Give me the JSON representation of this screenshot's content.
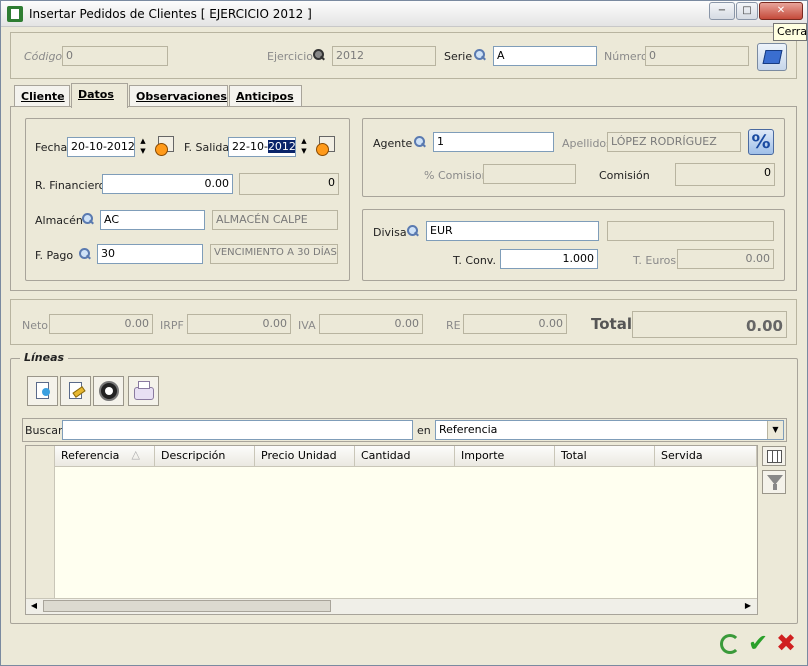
{
  "window": {
    "title": "Insertar Pedidos de Clientes [ EJERCICIO 2012 ]",
    "tooltip": "Cerrar"
  },
  "titlebar": {
    "min_glyph": "−",
    "max_glyph": "□",
    "close_glyph": "✕"
  },
  "header": {
    "codigo_label": "Código",
    "codigo_value": "0",
    "ejercicio_label": "Ejercicio",
    "ejercicio_value": "2012",
    "serie_label": "Serie",
    "serie_value": "A",
    "numero_label": "Número",
    "numero_value": "0"
  },
  "tabs": [
    {
      "label": "Cliente"
    },
    {
      "label": "Datos"
    },
    {
      "label": "Observaciones"
    },
    {
      "label": "Anticipos"
    }
  ],
  "datos": {
    "fecha_label": "Fecha",
    "fecha_value": "20-10-2012",
    "fsalida_label": "F. Salida",
    "fsalida_prefix": "22-10-",
    "fsalida_selected": "2012",
    "rfin_label": "R. Financiero",
    "rfin_value": "0.00",
    "rfin_amount": "0",
    "almacen_label": "Almacén",
    "almacen_code": "AC",
    "almacen_name": "ALMACÉN CALPE",
    "fpago_label": "F. Pago",
    "fpago_code": "30",
    "fpago_desc": "VENCIMIENTO A 30 DÍAS",
    "agente_label": "Agente",
    "agente_value": "1",
    "apellidos_label": "Apellidos",
    "apellidos_value": "LÓPEZ RODRÍGUEZ",
    "pct_symbol": "%",
    "pct_comision_label": "% Comision",
    "pct_comision_value": "",
    "comision_label": "Comisión",
    "comision_value": "0",
    "divisa_label": "Divisa",
    "divisa_value": "EUR",
    "divisa_desc": "",
    "tconv_label": "T. Conv.",
    "tconv_value": "1.000",
    "teuros_label": "T. Euros",
    "teuros_value": "0.00"
  },
  "totals": {
    "neto_label": "Neto",
    "neto_value": "0.00",
    "irpf_label": "IRPF",
    "irpf_value": "0.00",
    "iva_label": "IVA",
    "iva_value": "0.00",
    "re_label": "RE",
    "re_value": "0.00",
    "total_label": "Total",
    "total_value": "0.00"
  },
  "lineas": {
    "title": "Líneas",
    "buscar_label": "Buscar",
    "buscar_value": "",
    "en_label": "en",
    "en_value": "Referencia",
    "columns": [
      "Referencia",
      "Descripción",
      "Precio Unidad",
      "Cantidad",
      "Importe",
      "Total",
      "Servida"
    ]
  },
  "colors": {
    "accent": "#0a246a",
    "field_border": "#7f9db9",
    "grid_bg": "#fffff0"
  }
}
